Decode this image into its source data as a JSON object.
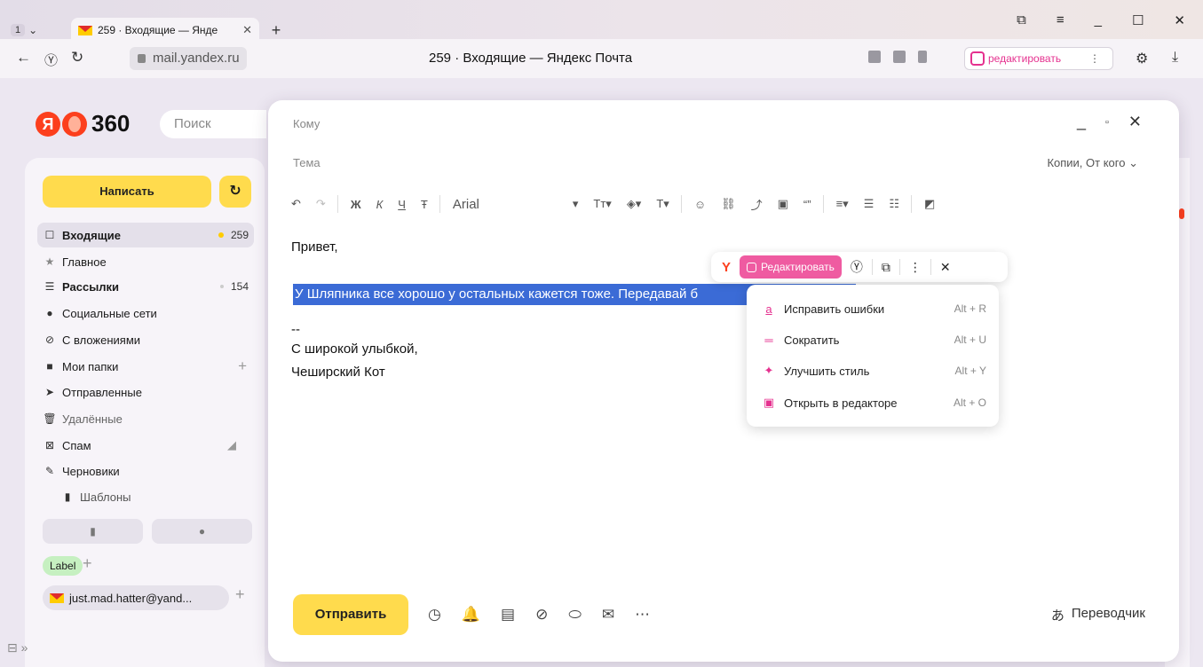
{
  "browser": {
    "tab_count": "1",
    "tab_title": "259 · Входящие — Янде",
    "url": "mail.yandex.ru",
    "page_title": "259 · Входящие — Яндекс Почта",
    "edit_ext_label": "редактировать"
  },
  "header": {
    "logo_text": "360",
    "search_placeholder": "Поиск"
  },
  "sidebar": {
    "compose_label": "Написать",
    "folders": [
      {
        "label": "Входящие",
        "count": "259",
        "icon": "inbox-icon"
      },
      {
        "label": "Главное",
        "icon": "star-icon"
      },
      {
        "label": "Рассылки",
        "count": "154",
        "icon": "newsletter-icon"
      },
      {
        "label": "Социальные сети",
        "icon": "social-icon"
      },
      {
        "label": "С вложениями",
        "icon": "paperclip-icon"
      },
      {
        "label": "Мои папки",
        "icon": "folder-icon"
      },
      {
        "label": "Отправленные",
        "icon": "send-icon"
      },
      {
        "label": "Удалённые",
        "icon": "trash-icon"
      },
      {
        "label": "Спам",
        "icon": "spam-icon"
      },
      {
        "label": "Черновики",
        "icon": "draft-icon"
      },
      {
        "label": "Шаблоны",
        "icon": "template-icon"
      }
    ],
    "label_chip": "Label",
    "account": "just.mad.hatter@yand..."
  },
  "compose": {
    "to_label": "Кому",
    "subject_label": "Тема",
    "copies_label": "Копии, От кого",
    "font": "Arial",
    "greeting": "Привет,",
    "selected_text": "У Шляпника все хорошо у остальных кажется тоже. Передавай б",
    "sig_dashes": "--",
    "sig_line1": "С широкой улыбкой,",
    "sig_line2": "Чеширский Кот",
    "send_label": "Отправить",
    "translator_label": "Переводчик"
  },
  "float_toolbar": {
    "edit_label": "Редактировать"
  },
  "menu": {
    "items": [
      {
        "label": "Исправить ошибки",
        "shortcut": "Alt + R",
        "icon": "fix-errors-icon"
      },
      {
        "label": "Сократить",
        "shortcut": "Alt + U",
        "icon": "shorten-icon"
      },
      {
        "label": "Улучшить стиль",
        "shortcut": "Alt + Y",
        "icon": "sparkle-icon"
      },
      {
        "label": "Открыть в редакторе",
        "shortcut": "Alt + O",
        "icon": "open-editor-icon"
      }
    ]
  },
  "colors": {
    "accent_yellow": "#ffdb4d",
    "selection_blue": "#3b6bd6",
    "edit_pink": "#ef5ba1",
    "yandex_red": "#fc3f1d"
  }
}
